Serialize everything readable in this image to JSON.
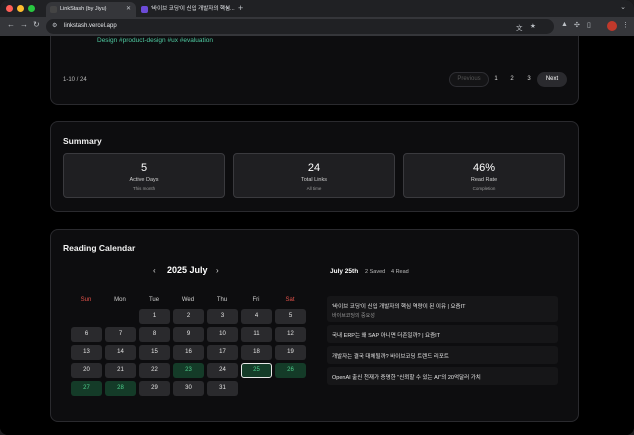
{
  "browser": {
    "tabs": [
      {
        "title": "LinkStash (by Jiyu)",
        "active": true
      },
      {
        "title": "'바이브 코딩'이 신입 개발자의 핵심...",
        "active": false
      }
    ],
    "url": "linkstash.vercel.app",
    "new_tab": "+"
  },
  "links_section": {
    "tags": "Design  #product-design  #ux  #evaluation",
    "range": "1-10 / 24",
    "prev_label": "Previous",
    "pages": [
      "1",
      "2",
      "3"
    ],
    "next_label": "Next"
  },
  "summary": {
    "title": "Summary",
    "stats": [
      {
        "value": "5",
        "label": "Active Days",
        "sub": "This month"
      },
      {
        "value": "24",
        "label": "Total Links",
        "sub": "All time"
      },
      {
        "value": "46%",
        "label": "Read Rate",
        "sub": "Completion"
      }
    ]
  },
  "calendar": {
    "title": "Reading Calendar",
    "month": "2025 July",
    "weekdays": [
      "Sun",
      "Mon",
      "Tue",
      "Wed",
      "Thu",
      "Fri",
      "Sat"
    ],
    "weekday_colors": {
      "sun": "#e5534b",
      "sat": "#e5534b",
      "default": "#cfcfcf"
    },
    "read_color": "#4fd18e",
    "days": [
      "1",
      "2",
      "3",
      "4",
      "5",
      "6",
      "7",
      "8",
      "9",
      "10",
      "11",
      "12",
      "13",
      "14",
      "15",
      "16",
      "17",
      "18",
      "19",
      "20",
      "21",
      "22",
      "23",
      "24",
      "25",
      "26",
      "27",
      "28",
      "29",
      "30",
      "31"
    ],
    "read_days": [
      "23",
      "25",
      "26",
      "27",
      "28"
    ],
    "selected_day": "25"
  },
  "day_detail": {
    "date": "July 25th",
    "saved": "2 Saved",
    "read": "4 Read",
    "entries": [
      {
        "title": "'바이브 코딩'이 신입 개발자의 핵심 역량이 된 이유 | 요즘IT",
        "tag": "바이브코딩의 중요성"
      },
      {
        "title": "국내 ERP는 왜 SAP 아니면 더존일까? | 요즘IT",
        "tag": ""
      },
      {
        "title": "개발자는 결국 대체될까? 바이브코딩 트렌드 리포트",
        "tag": ""
      },
      {
        "title": "OpenAI 출신 천재가 증명한 \"신뢰할 수 있는 AI\"의 20억달러 가치",
        "tag": ""
      }
    ]
  }
}
